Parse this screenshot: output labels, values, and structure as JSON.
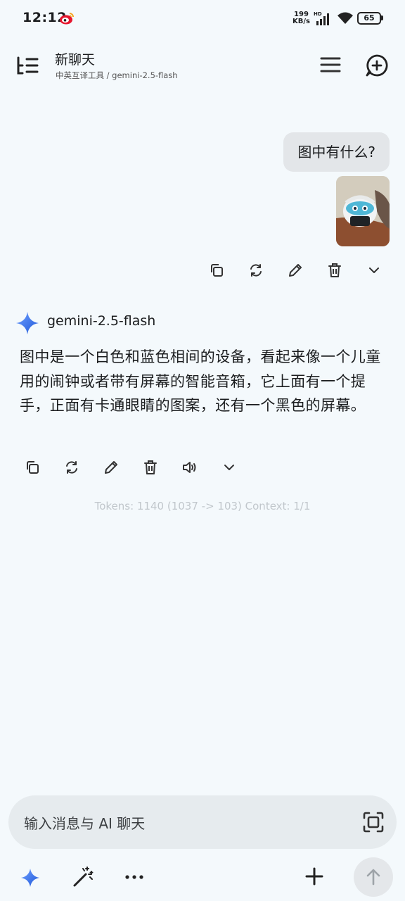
{
  "status_bar": {
    "time": "12:12",
    "net_speed_value": "199",
    "net_speed_unit": "KB/s",
    "hd_label": "HD",
    "battery": "65"
  },
  "header": {
    "title": "新聊天",
    "subtitle": "中英互译工具 / gemini-2.5-flash"
  },
  "user_message": {
    "text": "图中有什么?"
  },
  "assistant_message": {
    "model": "gemini-2.5-flash",
    "text": "图中是一个白色和蓝色相间的设备，看起来像一个儿童用的闹钟或者带有屏幕的智能音箱，它上面有一个提手，正面有卡通眼睛的图案，还有一个黑色的屏幕。",
    "token_info": "Tokens: 1140 (1037 -> 103)  Context: 1/1"
  },
  "input": {
    "placeholder": "输入消息与 AI 聊天"
  },
  "colors": {
    "background": "#f4f9fc",
    "bubble": "#e3e6e9",
    "gem_gradient_start": "#4f8bf5",
    "gem_gradient_end": "#1d56d8"
  }
}
